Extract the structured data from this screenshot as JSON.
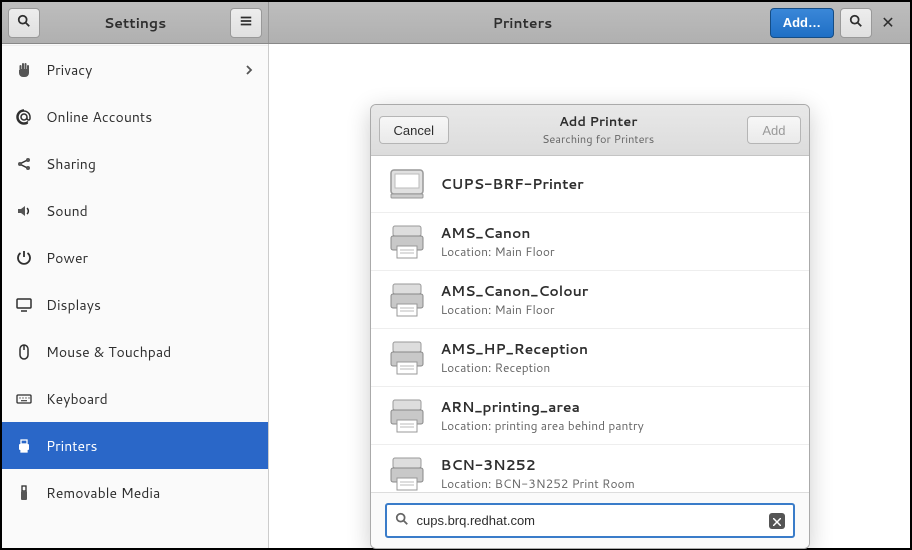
{
  "header": {
    "left_title": "Settings",
    "right_title": "Printers",
    "add_label": "Add…"
  },
  "sidebar": {
    "items": [
      {
        "icon": "hand",
        "label": "Privacy",
        "chevron": true
      },
      {
        "icon": "at",
        "label": "Online Accounts"
      },
      {
        "icon": "share",
        "label": "Sharing"
      },
      {
        "icon": "sound",
        "label": "Sound"
      },
      {
        "icon": "power",
        "label": "Power"
      },
      {
        "icon": "display",
        "label": "Displays"
      },
      {
        "icon": "mouse",
        "label": "Mouse & Touchpad"
      },
      {
        "icon": "keyboard",
        "label": "Keyboard"
      },
      {
        "icon": "printer",
        "label": "Printers",
        "selected": true
      },
      {
        "icon": "usb",
        "label": "Removable Media"
      }
    ]
  },
  "dialog": {
    "title": "Add Printer",
    "subtitle": "Searching for Printers",
    "cancel_label": "Cancel",
    "add_label": "Add",
    "search_value": "cups.brq.redhat.com",
    "printers": [
      {
        "name": "CUPS-BRF-Printer",
        "location": null,
        "style": "flat"
      },
      {
        "name": "AMS_Canon",
        "location": "Location: Main Floor",
        "style": "net"
      },
      {
        "name": "AMS_Canon_Colour",
        "location": "Location: Main Floor",
        "style": "net"
      },
      {
        "name": "AMS_HP_Reception",
        "location": "Location: Reception",
        "style": "net"
      },
      {
        "name": "ARN_printing_area",
        "location": "Location: printing area behind pantry",
        "style": "net"
      },
      {
        "name": "BCN-3N252",
        "location": "Location: BCN-3N252 Print Room",
        "style": "net"
      }
    ]
  }
}
